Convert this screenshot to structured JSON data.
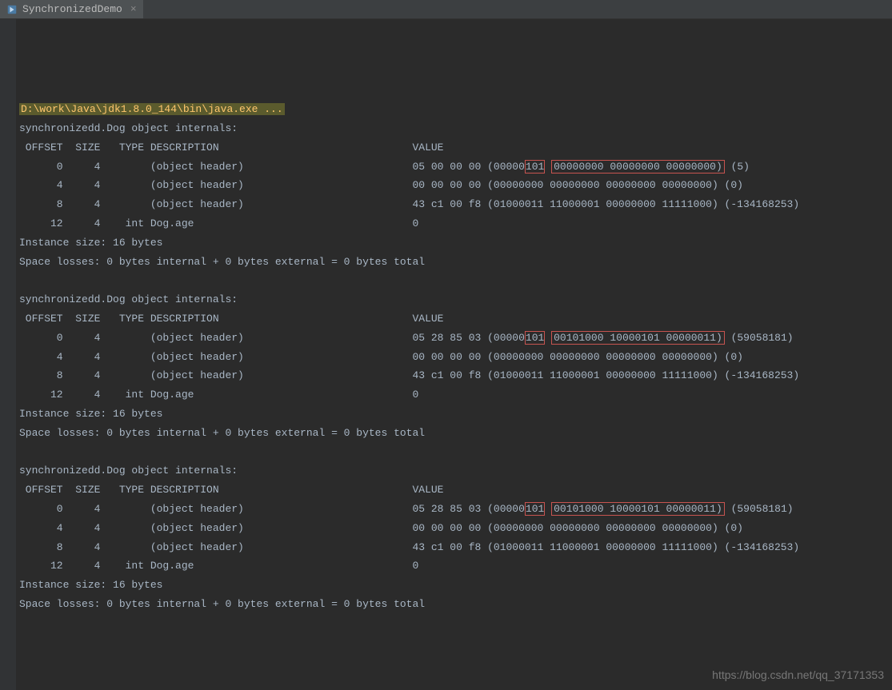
{
  "tab": {
    "title": "SynchronizedDemo",
    "close": "×"
  },
  "cmd": "D:\\work\\Java\\jdk1.8.0_144\\bin\\java.exe ...",
  "blocks": [
    {
      "header": "synchronizedd.Dog object internals:",
      "columns": " OFFSET  SIZE   TYPE DESCRIPTION                               VALUE",
      "rows": [
        {
          "prefix": "      0     4        (object header)                           05 00 00 00 (00000",
          "hl1": "101",
          "mid": " ",
          "hl2": "00000000 00000000 00000000)",
          "suffix": " (5)"
        },
        {
          "text": "      4     4        (object header)                           00 00 00 00 (00000000 00000000 00000000 00000000) (0)"
        },
        {
          "text": "      8     4        (object header)                           43 c1 00 f8 (01000011 11000001 00000000 11111000) (-134168253)"
        },
        {
          "text": "     12     4    int Dog.age                                   0"
        }
      ],
      "size": "Instance size: 16 bytes",
      "losses": "Space losses: 0 bytes internal + 0 bytes external = 0 bytes total"
    },
    {
      "header": "synchronizedd.Dog object internals:",
      "columns": " OFFSET  SIZE   TYPE DESCRIPTION                               VALUE",
      "rows": [
        {
          "prefix": "      0     4        (object header)                           05 28 85 03 (00000",
          "hl1": "101",
          "mid": " ",
          "hl2": "00101000 10000101 00000011)",
          "suffix": " (59058181)"
        },
        {
          "text": "      4     4        (object header)                           00 00 00 00 (00000000 00000000 00000000 00000000) (0)"
        },
        {
          "text": "      8     4        (object header)                           43 c1 00 f8 (01000011 11000001 00000000 11111000) (-134168253)"
        },
        {
          "text": "     12     4    int Dog.age                                   0"
        }
      ],
      "size": "Instance size: 16 bytes",
      "losses": "Space losses: 0 bytes internal + 0 bytes external = 0 bytes total"
    },
    {
      "header": "synchronizedd.Dog object internals:",
      "columns": " OFFSET  SIZE   TYPE DESCRIPTION                               VALUE",
      "rows": [
        {
          "prefix": "      0     4        (object header)                           05 28 85 03 (00000",
          "hl1": "101",
          "mid": " ",
          "hl2": "00101000 10000101 00000011)",
          "suffix": " (59058181)"
        },
        {
          "text": "      4     4        (object header)                           00 00 00 00 (00000000 00000000 00000000 00000000) (0)"
        },
        {
          "text": "      8     4        (object header)                           43 c1 00 f8 (01000011 11000001 00000000 11111000) (-134168253)"
        },
        {
          "text": "     12     4    int Dog.age                                   0"
        }
      ],
      "size": "Instance size: 16 bytes",
      "losses": "Space losses: 0 bytes internal + 0 bytes external = 0 bytes total"
    }
  ],
  "watermark": "https://blog.csdn.net/qq_37171353"
}
